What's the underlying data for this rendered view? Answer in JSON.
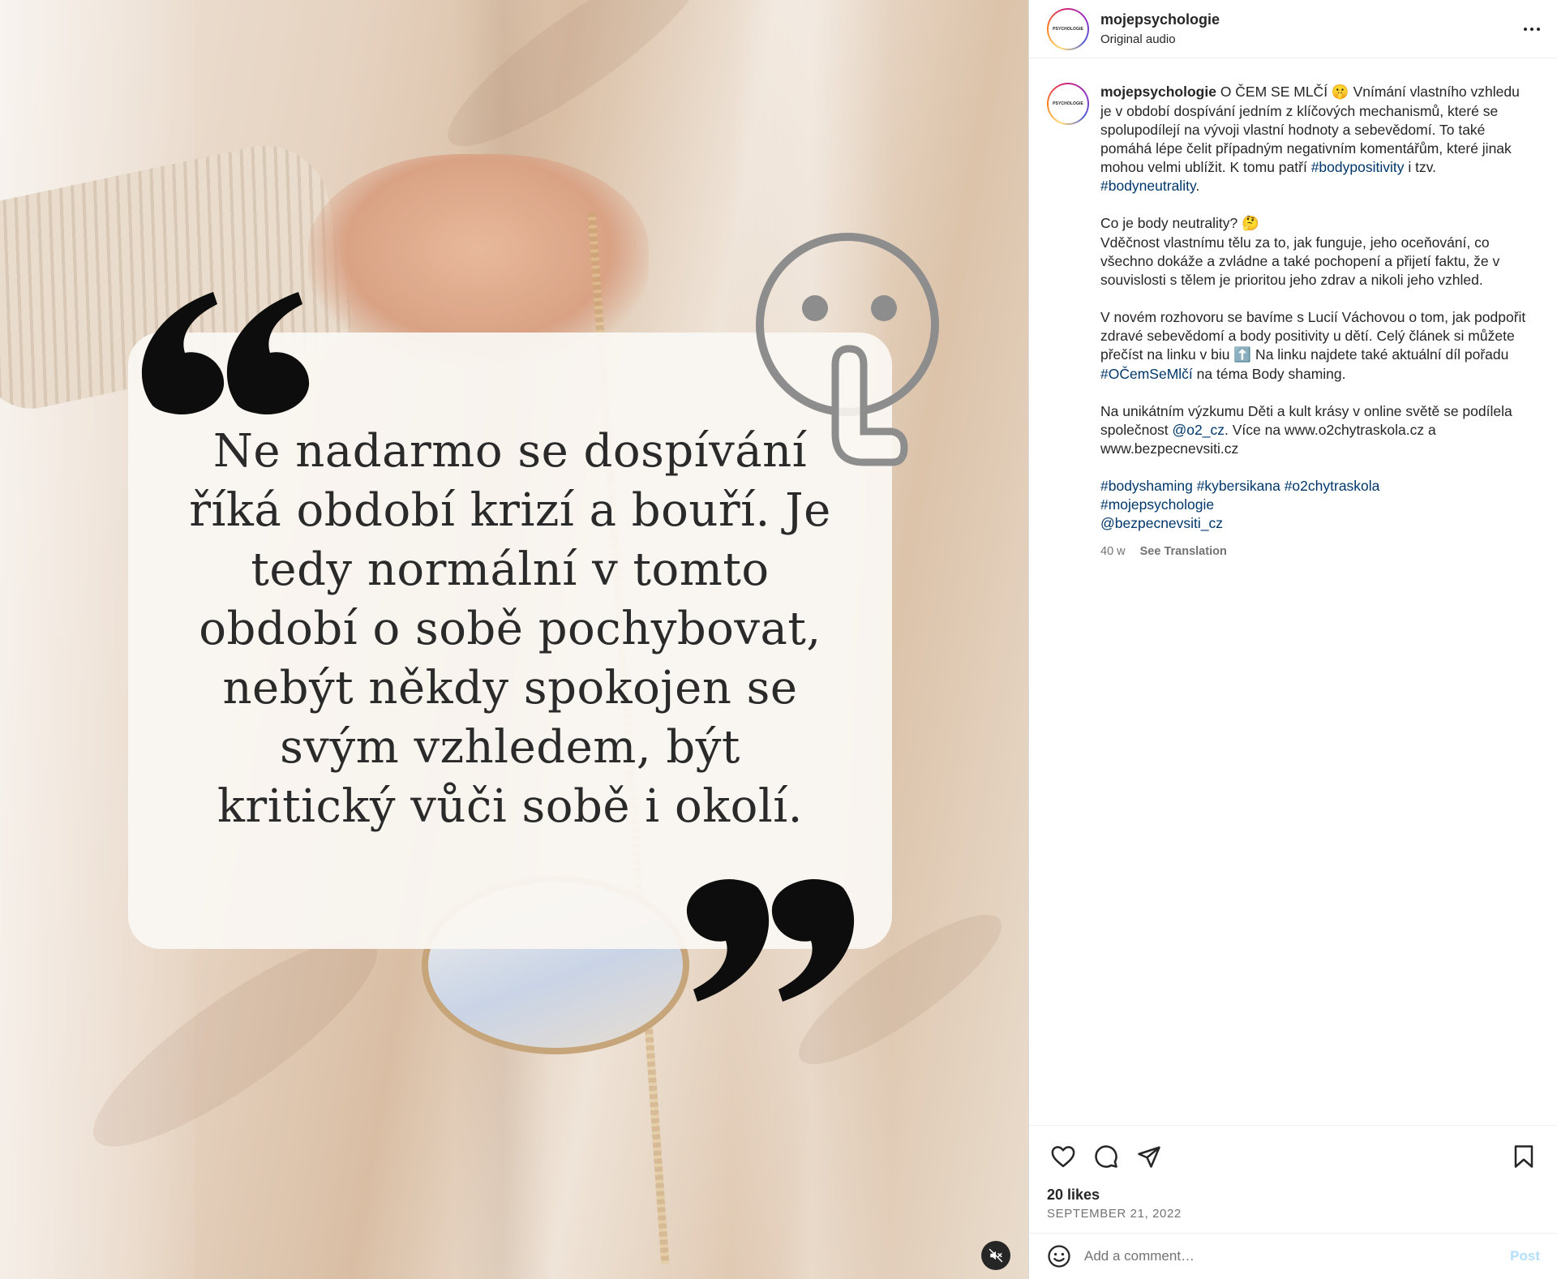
{
  "post": {
    "username": "mojepsychologie",
    "audio_label": "Original audio",
    "avatar_logo_text": "PSYCHOLOGIE",
    "more_icon": "more-horizontal-icon"
  },
  "media": {
    "quote_lines": [
      "Ne nadarmo se dospívání",
      "říká období krizí a bouří. Je",
      "tedy normální v tomto",
      "období o sobě pochybovat,",
      "nebýt někdy spokojen se",
      "svým vzhledem, být",
      "kritický vůči sobě i okolí."
    ],
    "mute_icon": "speaker-muted-icon"
  },
  "caption": {
    "username": "mojepsychologie",
    "p1_start": " O ČEM SE MLČÍ ",
    "emoji_shush": "🤫",
    "p1_rest": " Vnímání vlastního vzhledu je v období dospívání jedním z klíčových mechanismů, které se spolupodílejí na vývoji vlastní hodnoty a sebevědomí. To také pomáhá lépe čelit případným negativním komentářům, které jinak mohou velmi ublížit. K tomu patří ",
    "tag_bodypositivity": "#bodypositivity",
    "p1_mid": " i tzv. ",
    "tag_bodyneutrality": "#bodyneutrality",
    "p1_end": ".",
    "p2_q": "Co je body neutrality? ",
    "emoji_think": "🤔",
    "p2_body": "Vděčnost vlastnímu tělu za to, jak funguje, jeho oceňování, co všechno dokáže a zvládne a také pochopení a přijetí faktu, že v souvislosti s tělem je prioritou jeho zdrav a nikoli jeho vzhled.",
    "p3_start": "V novém rozhovoru se bavíme s Lucií Váchovou o tom, jak podpořit zdravé sebevědomí a body positivity u dětí. Celý článek si můžete přečíst na linku v biu ",
    "emoji_up": "⬆️",
    "p3_mid": " Na linku najdete také aktuální díl pořadu ",
    "tag_ocemsemlci": "#OČemSeMlčí",
    "p3_end": " na téma Body shaming.",
    "p4_start": "Na unikátním výzkumu Děti a kult krásy v online světě se podílela společnost ",
    "mention_o2": "@o2_cz",
    "p4_end": ". Více na www.o2chytraskola.cz a www.bezpecnevsiti.cz",
    "tag_bodyshaming": "#bodyshaming",
    "tag_kybersikana": "#kybersikana",
    "tag_o2chytraskola": "#o2chytraskola",
    "tag_mojepsychologie": "#mojepsychologie",
    "mention_bezpecnevsiti": "@bezpecnevsiti_cz",
    "age": "40 w",
    "see_translation": "See Translation"
  },
  "actions": {
    "like_icon": "heart-icon",
    "comment_icon": "comment-bubble-icon",
    "share_icon": "paper-plane-icon",
    "save_icon": "bookmark-icon",
    "likes": "20 likes",
    "date": "SEPTEMBER 21, 2022"
  },
  "comment": {
    "placeholder": "Add a comment…",
    "post_label": "Post",
    "emoji_icon": "smiley-icon"
  }
}
